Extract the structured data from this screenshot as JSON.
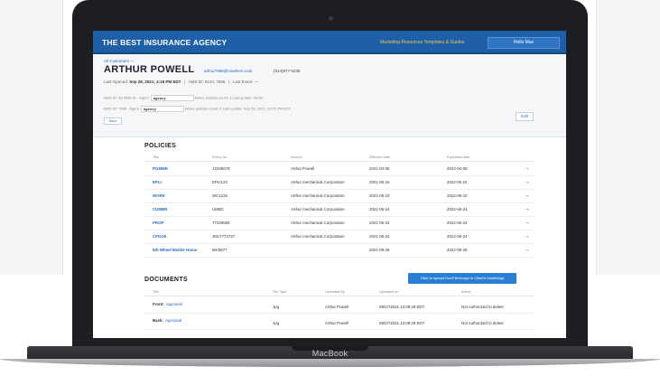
{
  "laptop": {
    "brand": "MacBook"
  },
  "header": {
    "title": "THE BEST INSURANCE AGENCY",
    "links": "Marketing Resources Templates & Guides",
    "user": "Hello Max"
  },
  "customer": {
    "breadcrumb": "All Customers —",
    "name": "ARTHUR POWELL",
    "email": "arthur7996@nowhere.com",
    "phone": "(614)877-0235",
    "opened_label": "Last Opened:",
    "opened_value": "Sep 28, 2021; 4:18 PM EDT",
    "ams_id": "AMS ID: 9143, 7996",
    "last_event": "Last Event: —",
    "agency_row1": {
      "prefix": "AMS ID: No AMS ID · Agent:",
      "select": "agency",
      "suffix": "Active policies count: 1 Last update: Never"
    },
    "agency_row2": {
      "prefix": "AMS ID: 7996 · Agent:",
      "select": "agency",
      "suffix": "Active policies count: 6 Last update: Sep 28, 2021, 10:01 PM EDT"
    },
    "save_label": "Save",
    "edit_label": "Edit"
  },
  "policies": {
    "title": "POLICIES",
    "columns": [
      "Title",
      "Policy No.",
      "Insured",
      "Effective date",
      "Expiration date"
    ],
    "rows": [
      {
        "title": "PGMMR",
        "policy": "12345678",
        "insured": "Arthur Powell",
        "effective": "2021-04-05",
        "expiration": "2022-04-05"
      },
      {
        "title": "EPLI",
        "policy": "EPLI123",
        "insured": "Arthur mechanical Corporation",
        "effective": "2021-06-10",
        "expiration": "2022-06-10"
      },
      {
        "title": "WORK",
        "policy": "WC1234",
        "insured": "Arthur mechanical Corporation",
        "effective": "2021-06-10",
        "expiration": "2022-06-10"
      },
      {
        "title": "CUMBR",
        "policy": "UMBC",
        "insured": "Arthur mechanical Corporation",
        "effective": "2021-06-24",
        "expiration": "2022-06-24"
      },
      {
        "title": "PROP",
        "policy": "77325555",
        "insured": "Arthur mechanical Corporation",
        "effective": "2021-06-24",
        "expiration": "2022-06-24"
      },
      {
        "title": "CPKGE",
        "policy": "JKK7773727",
        "insured": "Arthur mechanical Corporation",
        "effective": "2021-06-24",
        "expiration": "2022-06-24"
      },
      {
        "title": "5th Wheel Mobile Home",
        "policy": "MH3877",
        "insured": "",
        "effective": "2021-09-26",
        "expiration": "2022-09-26"
      }
    ],
    "arrow": "→"
  },
  "documents": {
    "title": "DOCUMENTS",
    "upload_label": "Click to upload Doc/File/Image in Client's MobileApp",
    "columns": [
      "Title",
      "File Type",
      "Uploaded By",
      "Uploaded on",
      "Action"
    ],
    "rows": [
      {
        "title_prefix": "Front:",
        "title_link": "Appraisal",
        "type": "Jpg",
        "by": "Arthur Powell",
        "on": "09/27/2021 12:08:29 EDT",
        "action": "Not Authorized to delete"
      },
      {
        "title_prefix": "Back:",
        "title_link": "Appraisal",
        "type": "Jpg",
        "by": "Arthur Powell",
        "on": "09/27/2021 12:08:29 EDT",
        "action": "Not Authorized to delete"
      }
    ]
  }
}
